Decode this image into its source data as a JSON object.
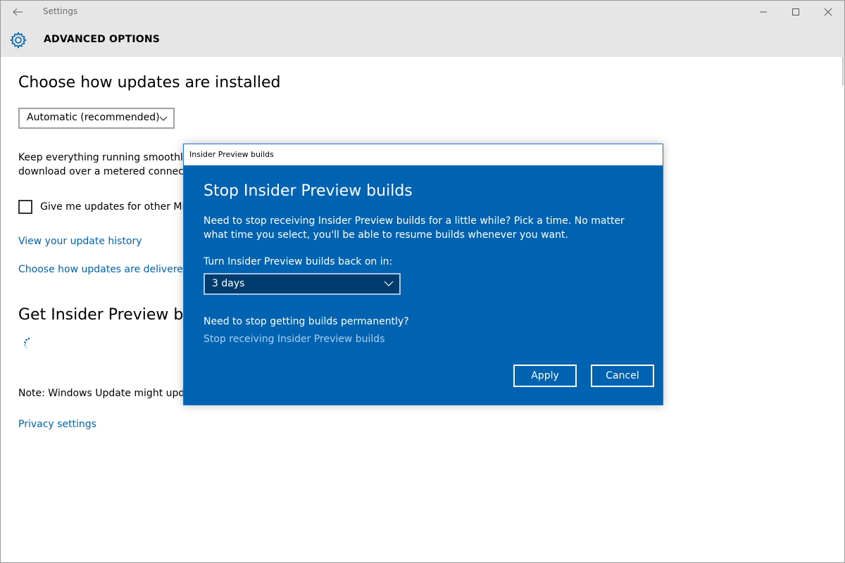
{
  "window": {
    "title": "Settings"
  },
  "header": {
    "title": "ADVANCED OPTIONS"
  },
  "main": {
    "heading": "Choose how updates are installed",
    "install_select": "Automatic (recommended)",
    "paragraph_line1": "Keep everything running smoothly.",
    "paragraph_line2": "download over a metered connectio",
    "checkbox_label": "Give me updates for other Micr",
    "link_history": "View your update history",
    "link_delivered": "Choose how updates are delivered",
    "insider_heading": "Get Insider Preview buil",
    "note": "Note: Windows Update might upda",
    "link_privacy": "Privacy settings"
  },
  "dialog": {
    "window_title": "Insider Preview builds",
    "heading": "Stop Insider Preview builds",
    "description": "Need to stop receiving Insider Preview builds for a little while? Pick a time. No matter what time you select, you'll be able to resume builds whenever you want.",
    "select_label": "Turn Insider Preview builds back on in:",
    "select_value": "3 days",
    "question": "Need to stop getting builds permanently?",
    "stop_link": "Stop receiving Insider Preview builds",
    "apply_label": "Apply",
    "cancel_label": "Cancel"
  },
  "colors": {
    "accent": "#0063b1",
    "link": "#0063b1",
    "dialog_link": "#a8d0f5",
    "titlebar_bg": "#e6e6e6"
  },
  "icons": {
    "back": "arrow-left",
    "minimize": "minimize",
    "maximize": "square",
    "close": "x",
    "header": "gear",
    "loading": "spinner-dots",
    "dropdown": "chevron-down"
  }
}
